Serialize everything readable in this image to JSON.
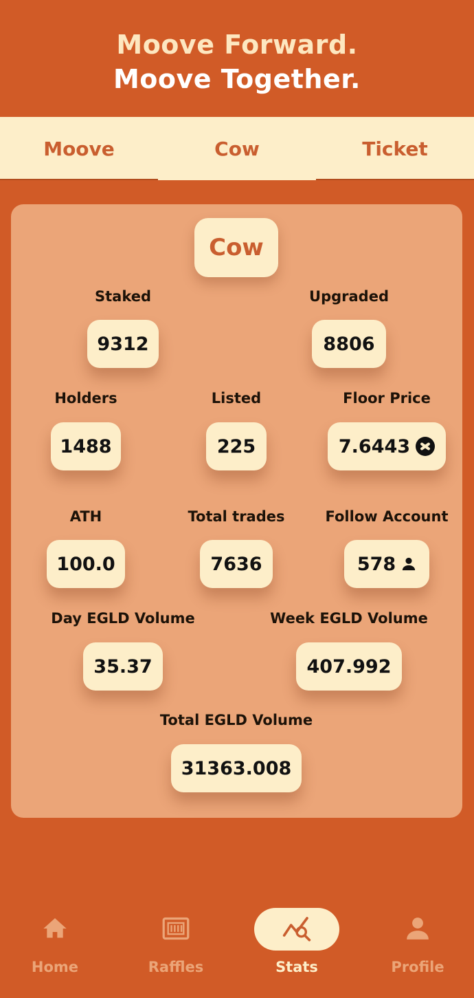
{
  "header": {
    "line1": "Moove Forward.",
    "line2": "Moove Together."
  },
  "tabs": [
    {
      "label": "Moove",
      "active": false
    },
    {
      "label": "Cow",
      "active": true
    },
    {
      "label": "Ticket",
      "active": false
    }
  ],
  "card": {
    "title": "Cow",
    "stats": {
      "staked": {
        "label": "Staked",
        "value": "9312"
      },
      "upgraded": {
        "label": "Upgraded",
        "value": "8806"
      },
      "holders": {
        "label": "Holders",
        "value": "1488"
      },
      "listed": {
        "label": "Listed",
        "value": "225"
      },
      "floor_price": {
        "label": "Floor Price",
        "value": "7.6443",
        "icon": "egld-icon"
      },
      "ath": {
        "label": "ATH",
        "value": "100.0"
      },
      "total_trades": {
        "label": "Total trades",
        "value": "7636"
      },
      "follow_account": {
        "label": "Follow Account",
        "value": "578",
        "icon": "person-icon"
      },
      "day_volume": {
        "label": "Day EGLD Volume",
        "value": "35.37"
      },
      "week_volume": {
        "label": "Week EGLD Volume",
        "value": "407.992"
      },
      "total_volume": {
        "label": "Total EGLD Volume",
        "value": "31363.008"
      }
    }
  },
  "nav": [
    {
      "label": "Home",
      "icon": "home-icon",
      "active": false
    },
    {
      "label": "Raffles",
      "icon": "ticket-icon",
      "active": false
    },
    {
      "label": "Stats",
      "icon": "stats-icon",
      "active": true
    },
    {
      "label": "Profile",
      "icon": "profile-icon",
      "active": false
    }
  ],
  "colors": {
    "background": "#d15b27",
    "cream": "#fdeec9",
    "card": "#eba578",
    "accent_text": "#c95e2f"
  }
}
